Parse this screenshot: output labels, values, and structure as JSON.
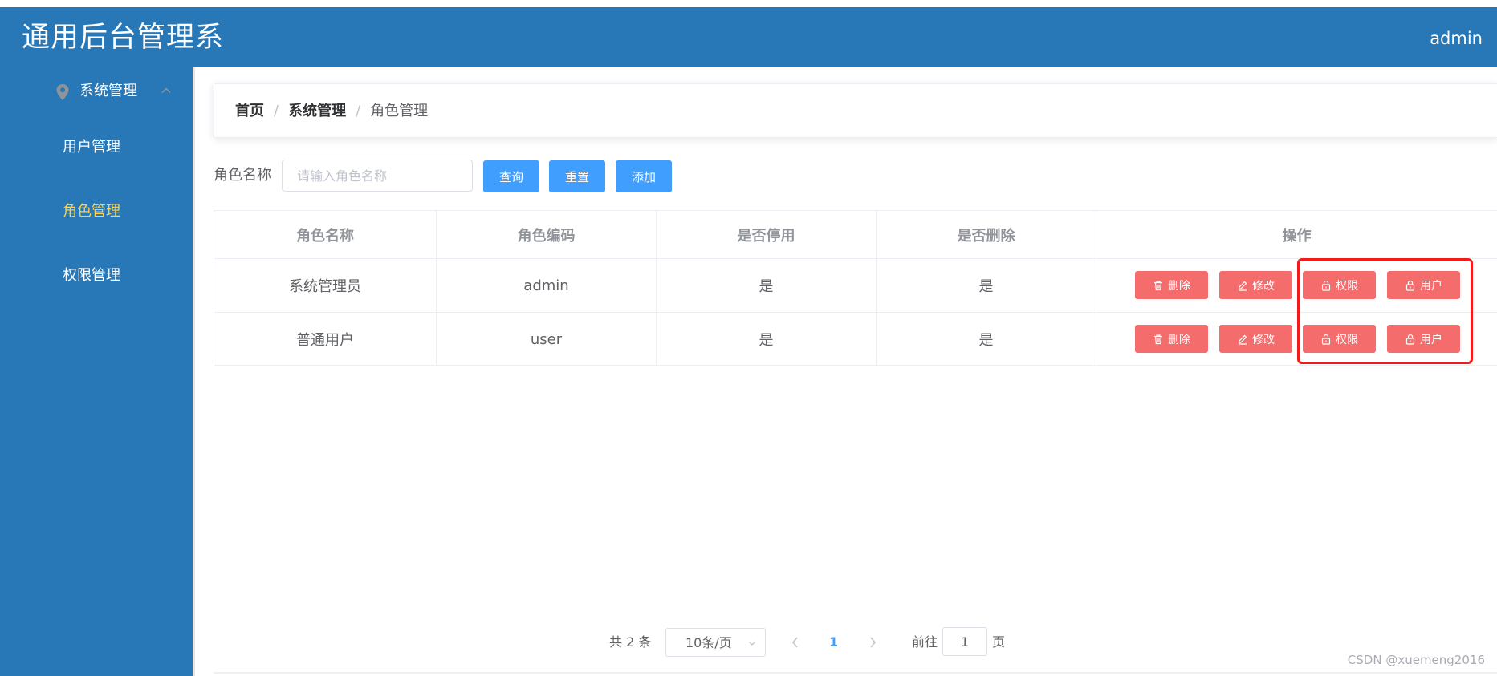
{
  "header": {
    "app_title": "通用后台管理系",
    "user": "admin"
  },
  "sidebar": {
    "group_label": "系统管理",
    "items": [
      {
        "label": "用户管理",
        "active": false
      },
      {
        "label": "角色管理",
        "active": true
      },
      {
        "label": "权限管理",
        "active": false
      }
    ],
    "colors": {
      "background": "#2878b8",
      "active_text": "#ffd04b"
    }
  },
  "breadcrumb": {
    "home": "首页",
    "section": "系统管理",
    "current": "角色管理",
    "separator": "/"
  },
  "search": {
    "label": "角色名称",
    "placeholder": "请输入角色名称",
    "value": "",
    "query_button": "查询",
    "reset_button": "重置",
    "add_button": "添加"
  },
  "table": {
    "columns": [
      "角色名称",
      "角色编码",
      "是否停用",
      "是否删除",
      "操作"
    ],
    "rows": [
      {
        "name": "系统管理员",
        "code": "admin",
        "disabled": "是",
        "deleted": "是"
      },
      {
        "name": "普通用户",
        "code": "user",
        "disabled": "是",
        "deleted": "是"
      }
    ],
    "actions": {
      "delete": "删除",
      "edit": "修改",
      "permission": "权限",
      "user": "用户"
    }
  },
  "pagination": {
    "total_text": "共 2 条",
    "page_size": "10条/页",
    "current_page": "1",
    "goto_label": "前往",
    "goto_value": "1",
    "goto_unit": "页"
  },
  "watermark": "CSDN @xuemeng2016",
  "colors": {
    "primary": "#409eff",
    "danger": "#f56c6c",
    "highlight": "#ee1c1c"
  },
  "icons": [
    "location-icon",
    "chevron-up-icon",
    "delete-icon",
    "edit-icon",
    "lock-icon",
    "chevron-left-icon",
    "chevron-right-icon",
    "chevron-down-icon"
  ]
}
